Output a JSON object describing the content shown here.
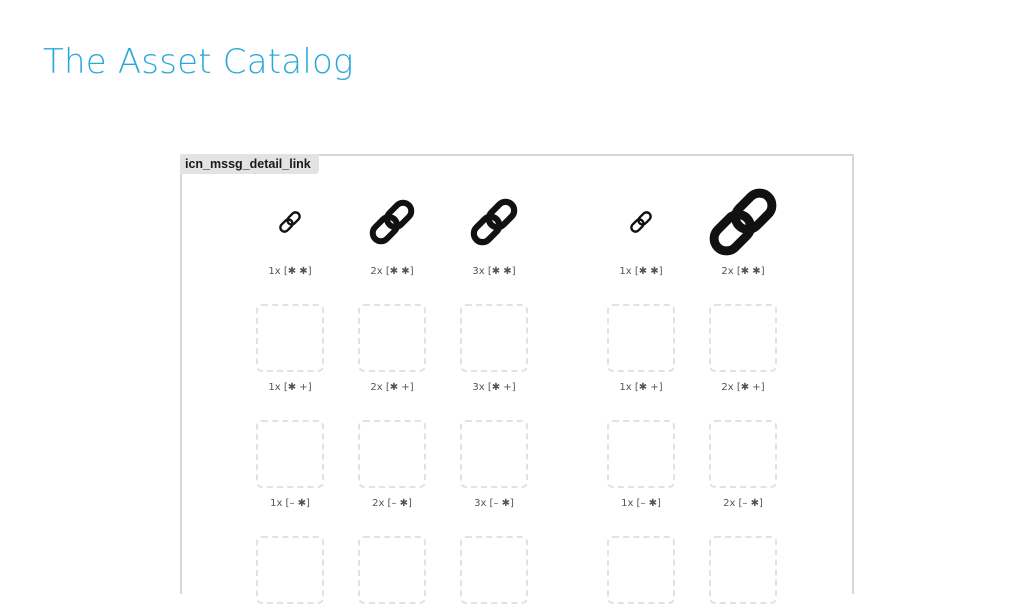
{
  "slide": {
    "title": "The Asset Catalog"
  },
  "image_set": {
    "name": "icn_mssg_detail_link",
    "rows": [
      {
        "filled": true,
        "groups": [
          {
            "slots": [
              {
                "label": "1x [✱ ✱]",
                "icon": "link-icon"
              },
              {
                "label": "2x [✱ ✱]",
                "icon": "link-icon"
              },
              {
                "label": "3x [✱ ✱]",
                "icon": "link-icon"
              }
            ]
          },
          {
            "slots": [
              {
                "label": "1x [✱ ✱]",
                "icon": "link-icon"
              },
              {
                "label": "2x [✱ ✱]",
                "icon": "link-icon"
              }
            ]
          }
        ]
      },
      {
        "filled": false,
        "groups": [
          {
            "slots": [
              {
                "label": "1x [✱ +]"
              },
              {
                "label": "2x [✱ +]"
              },
              {
                "label": "3x [✱ +]"
              }
            ]
          },
          {
            "slots": [
              {
                "label": "1x [✱ +]"
              },
              {
                "label": "2x [✱ +]"
              }
            ]
          }
        ]
      },
      {
        "filled": false,
        "groups": [
          {
            "slots": [
              {
                "label": "1x [– ✱]"
              },
              {
                "label": "2x [– ✱]"
              },
              {
                "label": "3x [– ✱]"
              }
            ]
          },
          {
            "slots": [
              {
                "label": "1x [– ✱]"
              },
              {
                "label": "2x [– ✱]"
              }
            ]
          }
        ]
      },
      {
        "filled": false,
        "groups": [
          {
            "slots": [
              {},
              {},
              {}
            ]
          },
          {
            "slots": [
              {},
              {}
            ]
          }
        ]
      }
    ]
  }
}
